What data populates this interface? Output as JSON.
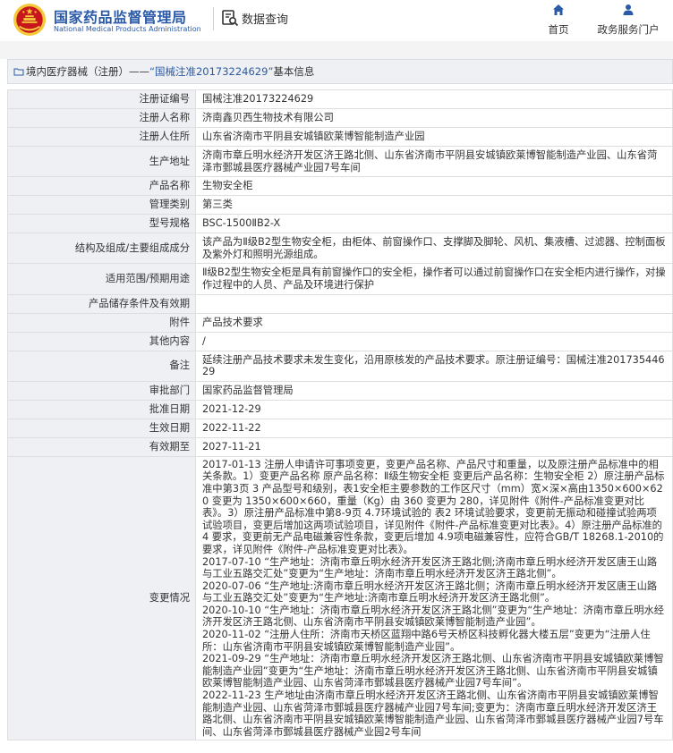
{
  "header": {
    "org_name_cn": "国家药品监督管理局",
    "org_name_en": "National Medical Products Administration",
    "query_label": "数据查询",
    "nav": [
      {
        "label": "首页",
        "icon": "home-icon"
      },
      {
        "label": "政务服务门户",
        "icon": "user-icon"
      }
    ]
  },
  "breadcrumb": {
    "prefix": "境内医疗器械（注册）——",
    "link": "“国械注准20173224629”",
    "suffix": "基本信息"
  },
  "colors": {
    "brand_blue": "#2b5aa8",
    "emblem_red": "#c8161d",
    "emblem_gold": "#f4c93a",
    "label_bg": "#eef0f4"
  },
  "fields": [
    {
      "label": "注册证编号",
      "value": "国械注准20173224629"
    },
    {
      "label": "注册人名称",
      "value": "济南鑫贝西生物技术有限公司"
    },
    {
      "label": "注册人住所",
      "value": "山东省济南市平阴县安城镇欧莱博智能制造产业园"
    },
    {
      "label": "生产地址",
      "value": "济南市章丘明水经济开发区济王路北侧、山东省济南市平阴县安城镇欧莱博智能制造产业园、山东省菏泽市鄄城县医疗器械产业园7号车间"
    },
    {
      "label": "产品名称",
      "value": "生物安全柜"
    },
    {
      "label": "管理类别",
      "value": "第三类"
    },
    {
      "label": "型号规格",
      "value": "BSC-1500ⅡB2-X"
    },
    {
      "label": "结构及组成/主要组成成分",
      "value": "该产品为Ⅱ级B2型生物安全柜，由柜体、前窗操作口、支撑脚及脚轮、风机、集液槽、过滤器、控制面板及紫外灯和照明光源组成。"
    },
    {
      "label": "适用范围/预期用途",
      "value": "Ⅱ级B2型生物安全柜是具有前窗操作口的安全柜，操作者可以通过前窗操作口在安全柜内进行操作，对操作过程中的人员、产品及环境进行保护"
    },
    {
      "label": "产品储存条件及有效期",
      "value": ""
    },
    {
      "label": "附件",
      "value": "产品技术要求"
    },
    {
      "label": "其他内容",
      "value": "/"
    },
    {
      "label": "备注",
      "value": "延续注册产品技术要求未发生变化，沿用原核发的产品技术要求。原注册证编号：国械注准20173544629"
    },
    {
      "label": "审批部门",
      "value": "国家药品监督管理局"
    },
    {
      "label": "批准日期",
      "value": "2021-12-29"
    },
    {
      "label": "生效日期",
      "value": "2022-11-22"
    },
    {
      "label": "有效期至",
      "value": "2027-11-21"
    }
  ],
  "changes": {
    "label": "变更情况",
    "entries": [
      "2017-01-13 注册人申请许可事项变更，变更产品名称、产品尺寸和重量，以及原注册产品标准中的相关条款。1）变更产品名称 原产品名称：Ⅱ级生物安全柜 变更后产品名称：生物安全柜 2）原注册产品标准中第3页 3 产品型号和级别，表1安全柜主要参数的工作区尺寸（mm）宽×深×高由1350×600×620 变更为 1350×600×660，重量（Kg）由 360 变更为 280，详见附件《附件-产品标准变更对比表》。3）原注册产品标准中第8-9页 4.7环境试验的 表2 环境试验要求，变更前无振动和碰撞试验两项试验项目，变更后增加这两项试验项目，详见附件《附件-产品标准变更对比表》。4）原注册产品标准的 4 要求，变更前无产品电磁兼容性条款，变更后增加 4.9项电磁兼容性，应符合GB/T 18268.1-2010的要求，详见附件《附件-产品标准变更对比表》。",
      "2017-07-10 “生产地址：济南市章丘明水经济开发区济王路北侧;济南市章丘明水经济开发区唐王山路与工业五路交汇处”变更为“生产地址：济南市章丘明水经济开发区济王路北侧”。",
      "2020-07-06 “生产地址:济南市章丘明水经济开发区济王路北侧；济南市章丘明水经济开发区唐王山路与工业五路交汇处”变更为“生产地址:济南市章丘明水经济开发区济王路北侧”。",
      "2020-10-10 “生产地址：济南市章丘明水经济开发区济王路北侧”变更为“生产地址：济南市章丘明水经济开发区济王路北侧、山东省济南市平阴县安城镇欧莱博智能制造产业园”。",
      "2020-11-02 “注册人住所：济南市天桥区蓝翔中路6号天桥区科技孵化器大楼五层”变更为“注册人住所：山东省济南市平阴县安城镇欧莱博智能制造产业园”。",
      "2021-09-29 “生产地址：济南市章丘明水经济开发区济王路北侧、山东省济南市平阴县安城镇欧莱博智能制造产业园”变更为“生产地址：济南市章丘明水经济开发区济王路北侧、山东省济南市平阴县安城镇欧莱博智能制造产业园、山东省菏泽市鄄城县医疗器械产业园7号车间”。",
      "2022-11-23 生产地址由济南市章丘明水经济开发区济王路北侧、山东省济南市平阴县安城镇欧莱博智能制造产业园、山东省菏泽市鄄城县医疗器械产业园7号车间;变更为：济南市章丘明水经济开发区济王路北侧、山东省济南市平阴县安城镇欧莱博智能制造产业园、山东省菏泽市鄄城县医疗器械产业园7号车间、山东省菏泽市鄄城县医疗器械产业园2号车间"
    ]
  }
}
